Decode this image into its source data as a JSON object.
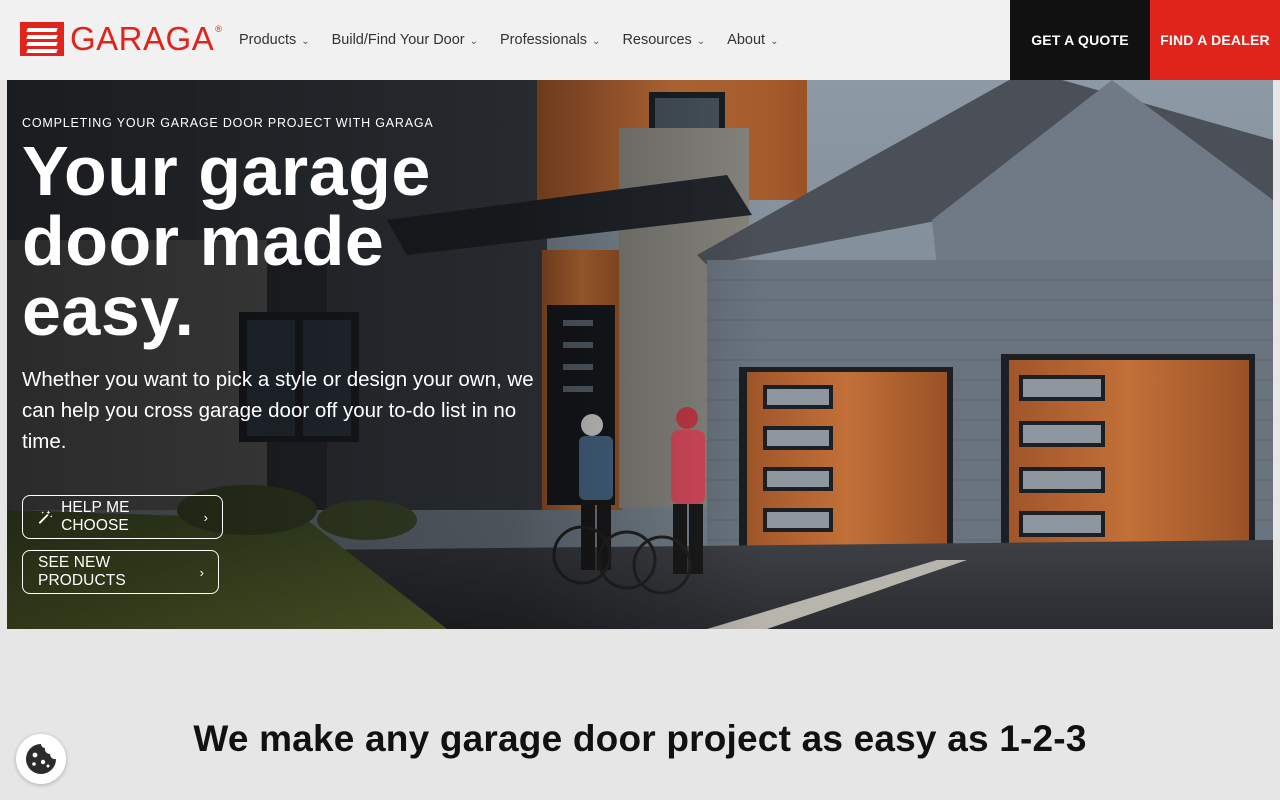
{
  "brand": {
    "name": "GARAGA",
    "reg": "®",
    "color": "#e0231b"
  },
  "nav": {
    "items": [
      {
        "label": "Products"
      },
      {
        "label": "Build/Find Your Door"
      },
      {
        "label": "Professionals"
      },
      {
        "label": "Resources"
      },
      {
        "label": "About"
      }
    ],
    "quote_label": "GET A QUOTE",
    "dealer_label": "FIND A DEALER"
  },
  "hero": {
    "eyebrow": "COMPLETING YOUR GARAGE DOOR PROJECT WITH GARAGA",
    "headline": "Your garage door made easy.",
    "subcopy": "Whether you want to pick a style or design your own, we can help you cross garage door off your to-do list in no time.",
    "buttons": {
      "help_label": "HELP ME CHOOSE",
      "new_label": "SEE NEW PRODUCTS"
    }
  },
  "section": {
    "title": "We make any garage door project as easy as 1-2-3"
  },
  "icons": {
    "chevron": "chevron-down-icon",
    "arrow": "chevron-right-icon",
    "wand": "magic-wand-icon",
    "cookie": "cookie-icon"
  }
}
